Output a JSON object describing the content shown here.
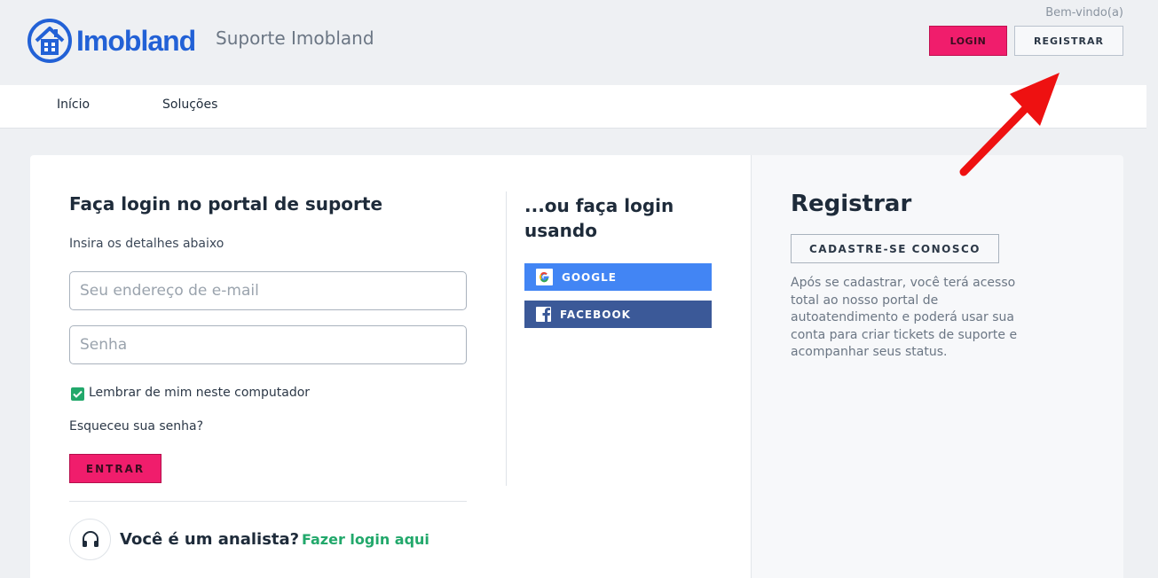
{
  "header": {
    "brand": "Imobland",
    "subtitle": "Suporte Imobland",
    "welcome": "Bem-vindo(a)",
    "login_label": "LOGIN",
    "register_label": "REGISTRAR"
  },
  "nav": {
    "items": [
      {
        "label": "Início"
      },
      {
        "label": "Soluções"
      }
    ]
  },
  "login": {
    "title": "Faça login no portal de suporte",
    "subtitle": "Insira os detalhes abaixo",
    "email_placeholder": "Seu endereço de e-mail",
    "password_placeholder": "Senha",
    "remember_label": "Lembrar de mim neste computador",
    "remember_checked": true,
    "forgot_label": "Esqueceu sua senha?",
    "enter_label": "ENTRAR"
  },
  "agent": {
    "question": "Você é um analista?",
    "link": "Fazer login aqui"
  },
  "social": {
    "title": "...ou faça login usando",
    "google_label": "GOOGLE",
    "facebook_label": "FACEBOOK"
  },
  "register": {
    "title": "Registrar",
    "button_label": "CADASTRE-SE CONOSCO",
    "description": "Após se cadastrar, você terá acesso total ao nosso portal de autoatendimento e poderá usar sua conta para criar tickets de suporte e acompanhar seus status."
  },
  "colors": {
    "brand_blue": "#2261d6",
    "accent_pink": "#f01d6c",
    "success_green": "#22a86b",
    "google_blue": "#4285f4",
    "facebook_blue": "#3b5998",
    "arrow_red": "#ee1111"
  }
}
